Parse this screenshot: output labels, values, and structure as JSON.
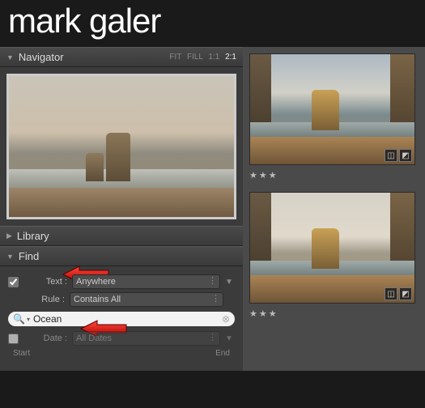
{
  "title": "mark galer",
  "navigator": {
    "label": "Navigator",
    "zoom": {
      "fit": "FIT",
      "fill": "FILL",
      "one": "1:1",
      "two": "2:1"
    }
  },
  "library": {
    "label": "Library"
  },
  "find": {
    "label": "Find",
    "text_label": "Text :",
    "text_select": "Anywhere",
    "rule_label": "Rule :",
    "rule_select": "Contains All",
    "search_value": "Ocean",
    "date_label": "Date :",
    "date_select": "All Dates",
    "start": "Start",
    "end": "End"
  },
  "thumbs": {
    "rating": "★★★"
  }
}
